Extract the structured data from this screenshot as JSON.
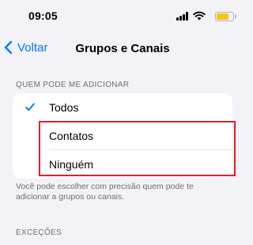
{
  "status_bar": {
    "time": "09:05",
    "icons": [
      "signal-icon",
      "wifi-icon",
      "battery-icon"
    ],
    "battery_level": 0.75,
    "battery_color": "#f5c518"
  },
  "nav": {
    "back_label": "Voltar",
    "title": "Grupos e Canais"
  },
  "section": {
    "header": "QUEM PODE ME ADICIONAR",
    "options": [
      {
        "label": "Todos",
        "selected": true
      },
      {
        "label": "Contatos",
        "selected": false
      },
      {
        "label": "Ninguém",
        "selected": false
      }
    ],
    "footer": "Você pode escolher com precisão quem pode te adicionar a grupos ou canais."
  },
  "exceptions": {
    "header": "EXCEÇÕES"
  },
  "colors": {
    "accent": "#007aff",
    "background": "#f2f2f7",
    "highlight": "#e0202c"
  }
}
